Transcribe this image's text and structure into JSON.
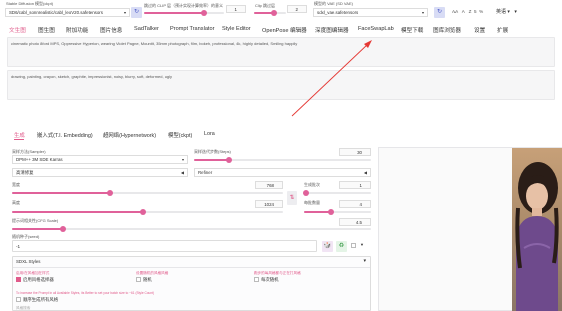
{
  "header": {
    "checkpoint_label": "Stable Diffusion 模型(ckpt)",
    "checkpoint_value": "SD6/cabl_sonnrealistic/cabl_leoV20.safetensors",
    "clip_label": "跳过的 CLIP 层（预计实现计算效率）的意义",
    "slider1_value": "1",
    "clip_skip_label": "Clip 跳过层",
    "clip_skip_value": "2",
    "vae_label": "模型的 VAE (SD VAE)",
    "vae_value": "sdxl_vae.safetensors",
    "lang_value": "英语",
    "toolbar_glyphs": [
      "A̶A",
      "A",
      "Z",
      "5",
      "%"
    ]
  },
  "tabs": [
    "文生图",
    "图生图",
    "附加功能",
    "图片信息",
    "SadTalker",
    "Prompt Translator",
    "Style Editor",
    "OpenPose 编辑器",
    "深度图编辑器",
    "FaceSwapLab",
    "模型下载",
    "图库浏览器",
    "设置",
    "扩展"
  ],
  "prompt": {
    "positive": "cinematic photo 8ford MPS, Oppressive Hyperion, wearing Violet Pagne, Mountit, 35mm photograph, film, bokeh, professional, 4k, highly detailed, Smiling happily",
    "negative": "drawing, painting, crayon, sketch, graphite, impressionist, noisy, blurry, soft, deformed, ugly"
  },
  "subtabs": [
    "生成",
    "嵌入式(T.I. Embedding)",
    "超网络(Hypernetwork)",
    "模型(ckpt)",
    "Lora"
  ],
  "params": {
    "sampler_label": "采样方法(Sampler)",
    "sampler_value": "DPM++ 3M SDE Karras",
    "steps_label": "采样迭代步数(Steps)",
    "steps_value": "30",
    "hires_label": "高清修复",
    "refiner_label": "Refiner",
    "width_label": "宽度",
    "width_value": "768",
    "height_label": "高度",
    "height_value": "1024",
    "batch_count_label": "生成批次",
    "batch_count_value": "1",
    "batch_size_label": "每批数量",
    "batch_size_value": "4",
    "cfg_label": "提示词相关性(CFG Scale)",
    "cfg_value": "4.5",
    "seed_label": "随机种子(seed)",
    "seed_value": "-1",
    "swap_icon": "⇅",
    "dice_icon": "🎲",
    "recycle_icon": "♻"
  },
  "styles": {
    "title": "SDXL Styles",
    "opt1_label": "启用/在风格加在样式",
    "opt1_check": "启用风格选择器",
    "opt2_label": "设置随机的风格风格",
    "opt2_check": "随机",
    "opt3_label": "跑步的每风格都与正在打风格",
    "opt3_check": "每次随机",
    "note": "To increase the Prompt in all Available Styles, its Better to set your batch size to ~61 (Style Count)",
    "opt4_check": "顺序生成所有风格",
    "search_placeholder": "风格搜索"
  },
  "colors": {
    "accent": "#e05a8a",
    "arrow": "#e53935"
  }
}
